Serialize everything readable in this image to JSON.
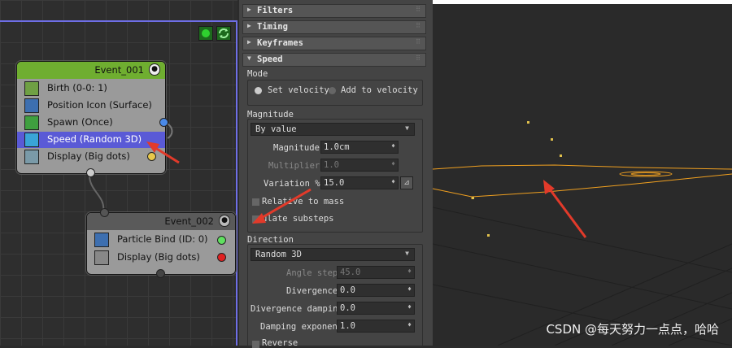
{
  "graph": {
    "event1": {
      "title": "Event_001",
      "operators": [
        {
          "label": "Birth (0-0: 1)",
          "icon": "birth-icon"
        },
        {
          "label": "Position Icon (Surface)",
          "icon": "position-icon"
        },
        {
          "label": "Spawn (Once)",
          "icon": "spawn-icon"
        },
        {
          "label": "Speed (Random 3D)",
          "icon": "speed-icon"
        },
        {
          "label": "Display (Big dots)",
          "icon": "display-icon"
        }
      ]
    },
    "event2": {
      "title": "Event_002",
      "operators": [
        {
          "label": "Particle Bind (ID: 0)",
          "icon": "particle-bind-icon"
        },
        {
          "label": "Display (Big dots)",
          "icon": "display-icon"
        }
      ]
    }
  },
  "panel": {
    "rollouts": [
      "Filters",
      "Timing",
      "Keyframes",
      "Speed"
    ],
    "mode": {
      "label": "Mode",
      "option1": "Set velocity",
      "option2": "Add to velocity"
    },
    "magnitude": {
      "label": "Magnitude",
      "dropdown": "By value",
      "magnitude_label": "Magnitude:",
      "magnitude_value": "1.0cm",
      "multiplier_label": "Multiplier:",
      "multiplier_value": "1.0",
      "variation_label": "Variation %:",
      "variation_value": "15.0",
      "relative_to_mass": "Relative to mass",
      "substeps_visible": "  ulate substeps"
    },
    "direction": {
      "label": "Direction",
      "dropdown": "Random 3D",
      "angle_step_label": "Angle step:",
      "angle_step_value": "45.0",
      "divergence_label": "Divergence:",
      "divergence_value": "0.0",
      "divergence_damping_label": "Divergence damping:",
      "divergence_damping_value": "0.0",
      "damping_exponent_label": "Damping exponent:",
      "damping_exponent_value": "1.0",
      "reverse": "Reverse"
    }
  },
  "watermark": "CSDN @每天努力一点点，哈哈",
  "colors": {
    "event1_header": "#6fae30",
    "event2_header": "#5a5a5a",
    "selected_row": "#5a5ad6",
    "accent_orange": "#f0a020",
    "arrow_red": "#e23a2a"
  }
}
